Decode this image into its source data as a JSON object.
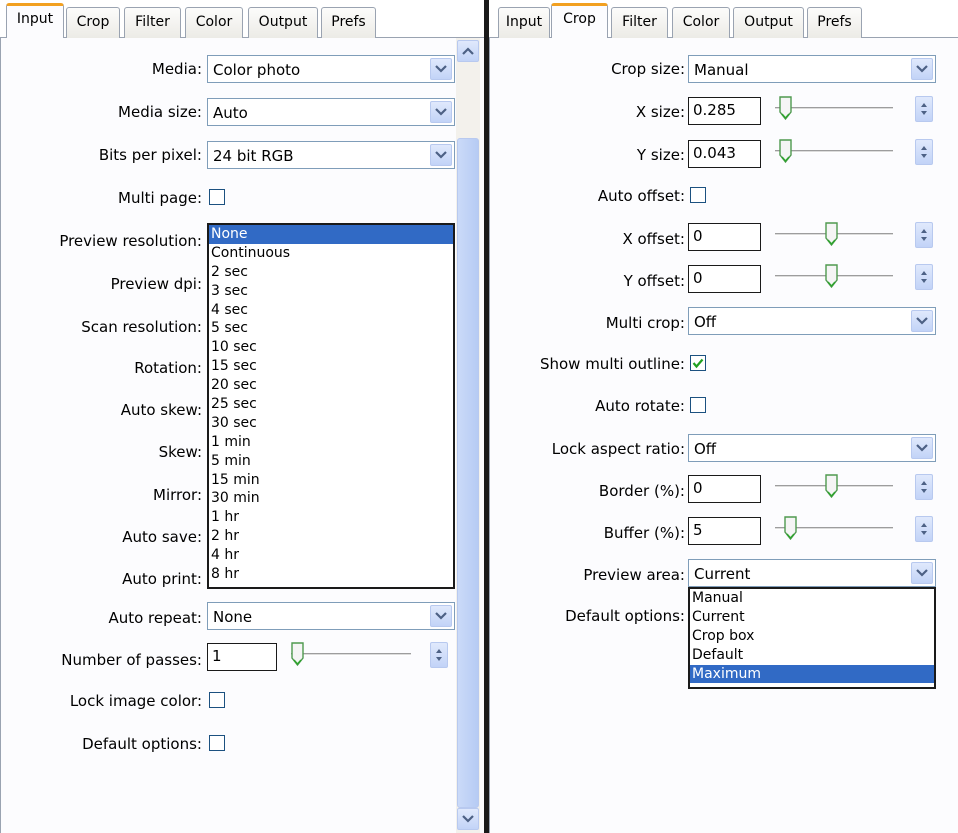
{
  "left": {
    "tabs": [
      "Input",
      "Crop",
      "Filter",
      "Color",
      "Output",
      "Prefs"
    ],
    "active_tab": "Input",
    "fields": {
      "media_label": "Media:",
      "media_value": "Color photo",
      "media_size_label": "Media size:",
      "media_size_value": "Auto",
      "bits_label": "Bits per pixel:",
      "bits_value": "24 bit RGB",
      "multi_page_label": "Multi page:",
      "preview_resolution_label": "Preview resolution:",
      "preview_dpi_label": "Preview dpi:",
      "scan_resolution_label": "Scan resolution:",
      "rotation_label": "Rotation:",
      "auto_skew_label": "Auto skew:",
      "skew_label": "Skew:",
      "mirror_label": "Mirror:",
      "auto_save_label": "Auto save:",
      "auto_print_label": "Auto print:",
      "auto_repeat_label": "Auto repeat:",
      "auto_repeat_value": "None",
      "passes_label": "Number of passes:",
      "passes_value": "1",
      "lock_color_label": "Lock image color:",
      "default_options_label": "Default options:"
    },
    "dropdown_options": [
      "None",
      "Continuous",
      "2 sec",
      "3 sec",
      "4 sec",
      "5 sec",
      "10 sec",
      "15 sec",
      "20 sec",
      "25 sec",
      "30 sec",
      "1 min",
      "5 min",
      "15 min",
      "30 min",
      "1 hr",
      "2 hr",
      "4 hr",
      "8 hr"
    ],
    "dropdown_selected": "None"
  },
  "right": {
    "tabs": [
      "Input",
      "Crop",
      "Filter",
      "Color",
      "Output",
      "Prefs"
    ],
    "active_tab": "Crop",
    "fields": {
      "crop_size_label": "Crop size:",
      "crop_size_value": "Manual",
      "x_size_label": "X size:",
      "x_size_value": "0.285",
      "y_size_label": "Y size:",
      "y_size_value": "0.043",
      "auto_offset_label": "Auto offset:",
      "x_offset_label": "X offset:",
      "x_offset_value": "0",
      "y_offset_label": "Y offset:",
      "y_offset_value": "0",
      "multi_crop_label": "Multi crop:",
      "multi_crop_value": "Off",
      "show_multi_label": "Show multi outline:",
      "auto_rotate_label": "Auto rotate:",
      "lock_aspect_label": "Lock aspect ratio:",
      "lock_aspect_value": "Off",
      "border_label": "Border (%):",
      "border_value": "0",
      "buffer_label": "Buffer (%):",
      "buffer_value": "5",
      "preview_area_label": "Preview area:",
      "preview_area_value": "Current",
      "default_options_label": "Default options:"
    },
    "dropdown_options": [
      "Manual",
      "Current",
      "Crop box",
      "Default",
      "Maximum"
    ],
    "dropdown_selected": "Maximum"
  },
  "colors": {
    "active_tab_accent": "#f2a020",
    "selection": "#316ac5",
    "checkmark": "#21a121"
  },
  "icons": [
    "chevron-down-icon",
    "spin-updown-icon",
    "slider-thumb-icon",
    "checkmark-icon",
    "scroll-up-icon",
    "scroll-down-icon"
  ]
}
